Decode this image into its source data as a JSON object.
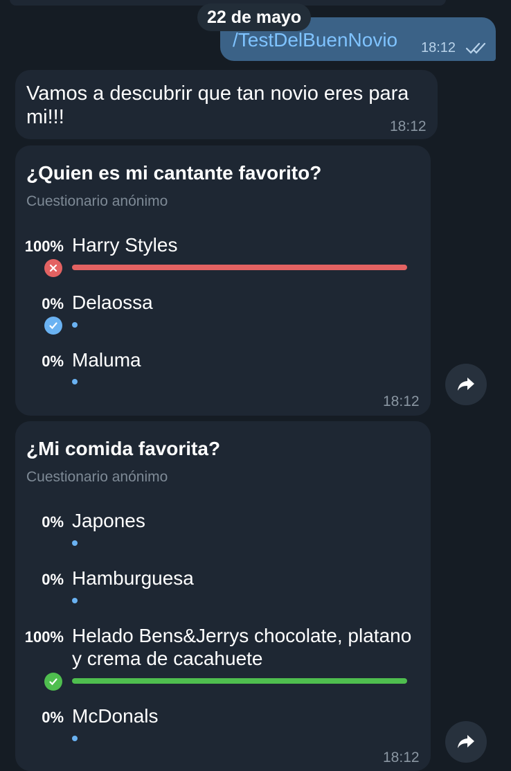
{
  "header": {
    "date": "22 de mayo"
  },
  "outgoing": {
    "text": "/TestDelBuenNovio",
    "time": "18:12"
  },
  "message": {
    "text": "Vamos a descubrir que tan novio eres para mi!!!",
    "time": "18:12"
  },
  "polls": [
    {
      "question": "¿Quien es mi cantante favorito?",
      "type": "Cuestionario anónimo",
      "time": "18:12",
      "options": [
        {
          "pct": "100%",
          "label": "Harry Styles",
          "fill": 1.0,
          "status": "wrong"
        },
        {
          "pct": "0%",
          "label": "Delaossa",
          "fill": 0,
          "status": "correct"
        },
        {
          "pct": "0%",
          "label": "Maluma",
          "fill": 0,
          "status": "none"
        }
      ]
    },
    {
      "question": "¿Mi comida favorita?",
      "type": "Cuestionario anónimo",
      "time": "18:12",
      "options": [
        {
          "pct": "0%",
          "label": "Japones",
          "fill": 0,
          "status": "none"
        },
        {
          "pct": "0%",
          "label": "Hamburguesa",
          "fill": 0,
          "status": "none"
        },
        {
          "pct": "100%",
          "label": "Helado Bens&Jerrys chocolate, platano y crema de cacahuete",
          "fill": 1.0,
          "status": "correct"
        },
        {
          "pct": "0%",
          "label": "McDonals",
          "fill": 0,
          "status": "none"
        }
      ]
    }
  ],
  "icons": {
    "wrong": "x-circle-icon",
    "correct": "check-circle-icon",
    "share": "share-arrow-icon",
    "read": "double-check-icon"
  },
  "colors": {
    "wrong": "#e36262",
    "correct": "#4fbe4f",
    "dot": "#6ab2f2",
    "outgoing_bubble": "#3b6287",
    "incoming_bubble": "#1e2733",
    "background": "#151c24"
  }
}
